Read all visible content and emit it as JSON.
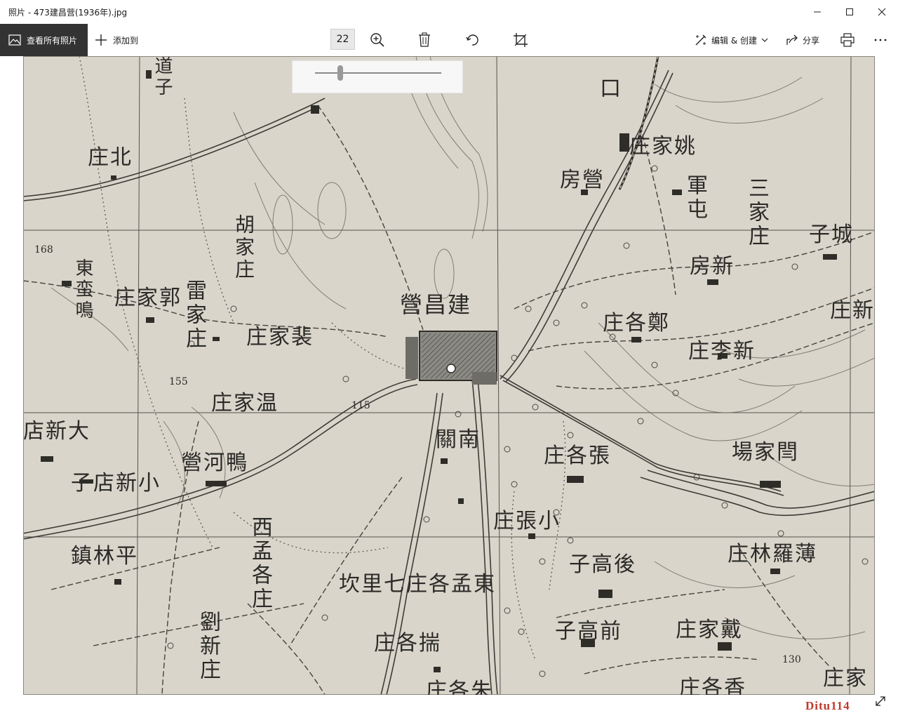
{
  "window": {
    "title": "照片 - 473建昌营(1936年).jpg"
  },
  "toolbar": {
    "all_photos_label": "查看所有照片",
    "add_to_label": "添加到",
    "zoom_value": "22",
    "edit_create_label": "编辑 & 创建",
    "share_label": "分享"
  },
  "zoom_slider": {
    "level": 0.2
  },
  "map": {
    "watermark": "Ditu114",
    "places": [
      {
        "text": "道子",
        "vertical": true
      },
      {
        "text": "庄北"
      },
      {
        "text": "胡家庄",
        "vertical": true
      },
      {
        "text": "東蛮鳴",
        "vertical": true
      },
      {
        "text": "庄家郭"
      },
      {
        "text": "雷家庄",
        "vertical": true
      },
      {
        "text": "庄家裴"
      },
      {
        "text": "庄家温"
      },
      {
        "text": "店新大"
      },
      {
        "text": "營河鴨"
      },
      {
        "text": "子店新小"
      },
      {
        "text": "鎮林平"
      },
      {
        "text": "西孟各庄",
        "vertical": true
      },
      {
        "text": "劉新庄",
        "vertical": true
      },
      {
        "text": "營昌建"
      },
      {
        "text": "關南"
      },
      {
        "text": "坎里七庄各孟東"
      },
      {
        "text": "庄各揣"
      },
      {
        "text": "庄各朱"
      },
      {
        "text": "口"
      },
      {
        "text": "庄家姚"
      },
      {
        "text": "房營"
      },
      {
        "text": "軍屯",
        "vertical": true
      },
      {
        "text": "三家庄",
        "vertical": true
      },
      {
        "text": "子城"
      },
      {
        "text": "房新"
      },
      {
        "text": "庄新"
      },
      {
        "text": "庄各鄭"
      },
      {
        "text": "庄李新"
      },
      {
        "text": "庄各張"
      },
      {
        "text": "場家閆"
      },
      {
        "text": "庄張小"
      },
      {
        "text": "庄林羅薄"
      },
      {
        "text": "子高後"
      },
      {
        "text": "子高前"
      },
      {
        "text": "庄家戴"
      },
      {
        "text": "庄各香"
      },
      {
        "text": "庄家"
      }
    ],
    "elevations": [
      "168",
      "155",
      "115",
      "130"
    ]
  },
  "colors": {
    "map_paper": "#d9d5cb",
    "map_ink": "#2b2a27",
    "toolbar_dark": "#333333",
    "watermark": "#c0392b"
  }
}
